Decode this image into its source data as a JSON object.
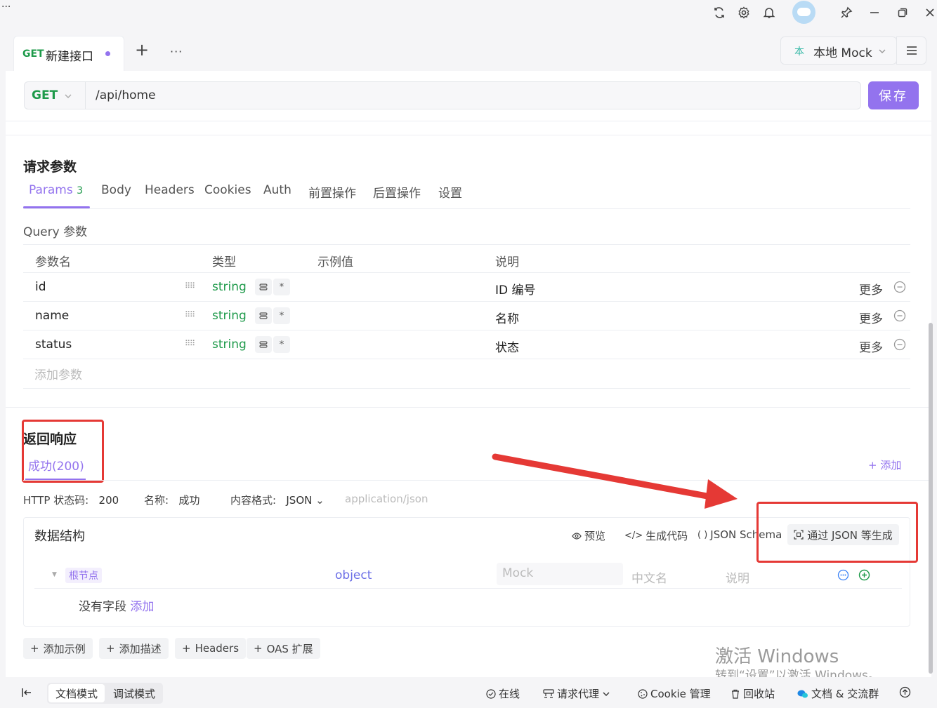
{
  "titlebar": {
    "menu_dots": "···"
  },
  "tabs": {
    "active": {
      "method": "GET",
      "title": "新建接口"
    },
    "add": "+",
    "more": "···",
    "mock_env": "本地 Mock",
    "mock_prefix": "本"
  },
  "request": {
    "method": "GET",
    "url": "/api/home",
    "save_label": "保存"
  },
  "params": {
    "section_title": "请求参数",
    "tabs": [
      {
        "label": "Params",
        "badge": "3"
      },
      {
        "label": "Body"
      },
      {
        "label": "Headers"
      },
      {
        "label": "Cookies"
      },
      {
        "label": "Auth"
      },
      {
        "label": "前置操作"
      },
      {
        "label": "后置操作"
      },
      {
        "label": "设置"
      }
    ],
    "query_label": "Query 参数",
    "columns": [
      "参数名",
      "类型",
      "示例值",
      "说明"
    ],
    "rows": [
      {
        "name": "id",
        "type": "string",
        "desc": "ID 编号",
        "more": "更多"
      },
      {
        "name": "name",
        "type": "string",
        "desc": "名称",
        "more": "更多"
      },
      {
        "name": "status",
        "type": "string",
        "desc": "状态",
        "more": "更多"
      }
    ],
    "add_placeholder": "添加参数"
  },
  "response": {
    "section_title": "返回响应",
    "tab": "成功(200)",
    "add_label": "添加",
    "meta": {
      "status_label": "HTTP 状态码:",
      "status_value": "200",
      "name_label": "名称:",
      "name_value": "成功",
      "format_label": "内容格式:",
      "format_value": "JSON",
      "mime": "application/json"
    },
    "schema": {
      "title": "数据结构",
      "actions": [
        "预览",
        "生成代码",
        "JSON Schema",
        "通过 JSON 等生成"
      ],
      "root_label": "根节点",
      "root_type": "object",
      "mock_placeholder": "Mock",
      "cn_placeholder": "中文名",
      "desc_placeholder": "说明",
      "no_field": "没有字段",
      "add_link": "添加"
    },
    "pills": [
      "添加示例",
      "添加描述",
      "Headers",
      "OAS 扩展"
    ]
  },
  "watermark": {
    "line1": "激活 Windows",
    "line2": "转到“设置”以激活 Windows。"
  },
  "statusbar": {
    "modes": [
      "文档模式",
      "调试模式"
    ],
    "items": [
      "在线",
      "请求代理",
      "Cookie 管理",
      "回收站",
      "文档 & 交流群"
    ]
  },
  "colors": {
    "accent": "#9373ee",
    "get": "#1e9a4a",
    "annotation": "#e53935"
  }
}
